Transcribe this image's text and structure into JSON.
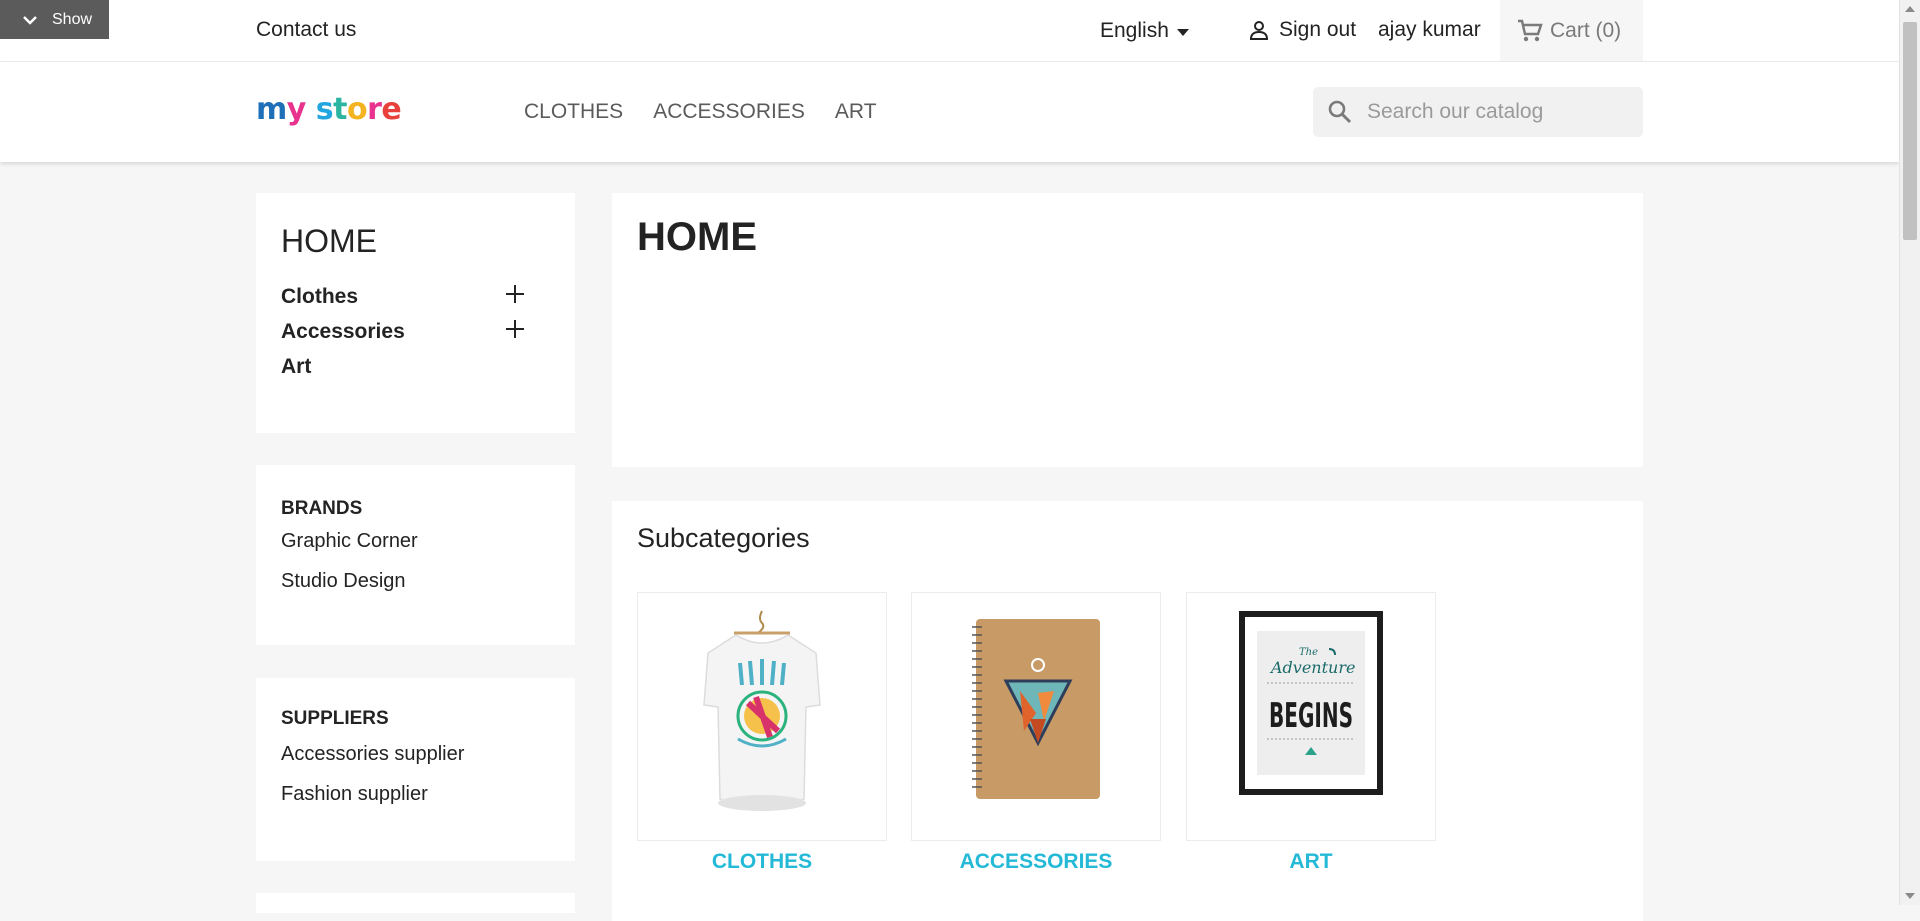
{
  "toolbar": {
    "show_label": "Show"
  },
  "topbar": {
    "contact": "Contact us",
    "language": "English",
    "sign_out": "Sign out",
    "username": "ajay kumar",
    "cart": "Cart (0)"
  },
  "header": {
    "logo": {
      "m": "m",
      "y": "y",
      "s": "s",
      "t": "t",
      "o": "o",
      "r": "r",
      "e": "e"
    },
    "nav": [
      "CLOTHES",
      "ACCESSORIES",
      "ART"
    ],
    "search_placeholder": "Search our catalog"
  },
  "sidebar": {
    "categories_title": "HOME",
    "categories": [
      "Clothes",
      "Accessories",
      "Art"
    ],
    "brands_title": "BRANDS",
    "brands": [
      "Graphic Corner",
      "Studio Design"
    ],
    "suppliers_title": "SUPPLIERS",
    "suppliers": [
      "Accessories supplier",
      "Fashion supplier"
    ]
  },
  "main": {
    "title": "HOME",
    "subcategories_title": "Subcategories",
    "subcategories": [
      "CLOTHES",
      "ACCESSORIES",
      "ART"
    ],
    "art_poster": {
      "line1": "The",
      "line2": "Adventure",
      "line3": "BEGINS"
    }
  },
  "colors": {
    "accent": "#24b9d7",
    "background": "#f6f6f6"
  }
}
